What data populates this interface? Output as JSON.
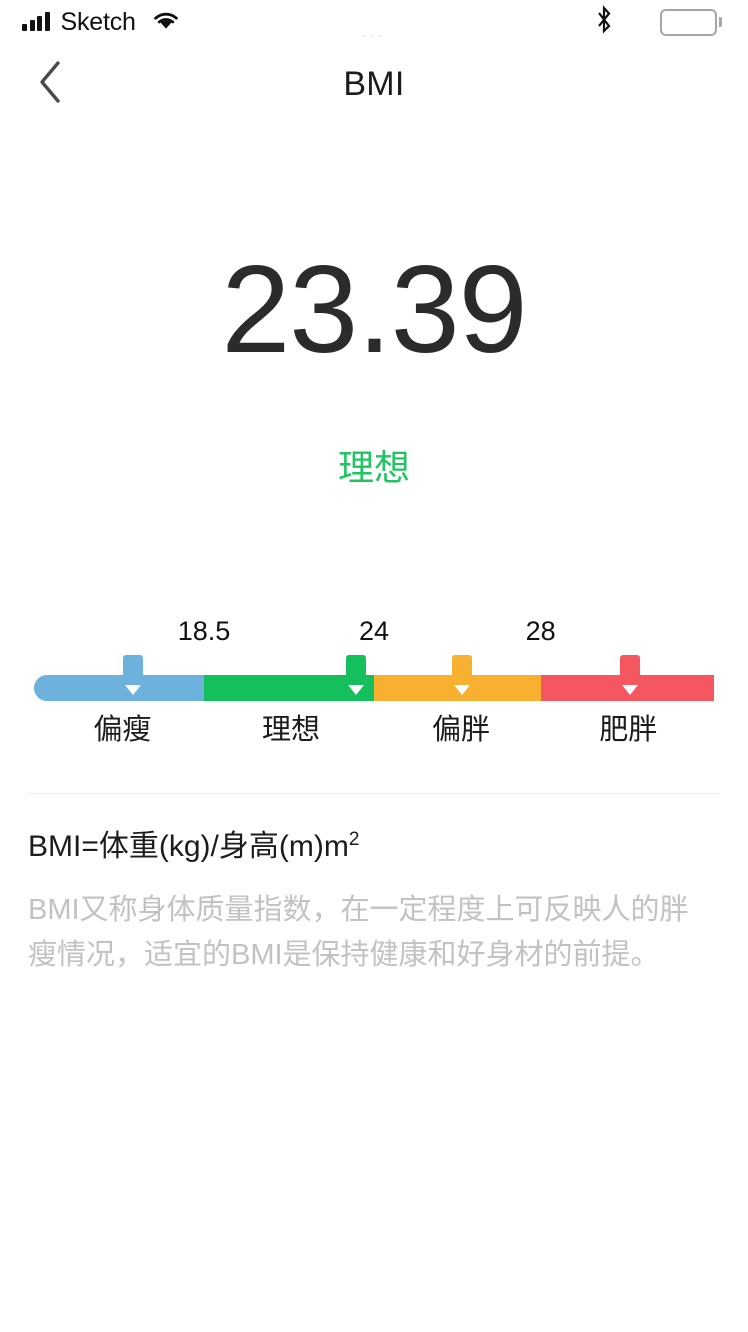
{
  "status_bar": {
    "carrier": "Sketch",
    "signal_icon": "signal-bars-icon",
    "wifi_icon": "wifi-icon",
    "bluetooth_icon": "bluetooth-icon",
    "battery_icon": "battery-full-icon",
    "notch_dots": "···"
  },
  "nav": {
    "back_icon": "chevron-left-icon",
    "title": "BMI"
  },
  "result": {
    "value": "23.39",
    "status_label": "理想",
    "status_color": "#22c362"
  },
  "scale": {
    "ticks": [
      {
        "label": "18.5",
        "position_pct": 25.0
      },
      {
        "label": "24",
        "position_pct": 50.0
      },
      {
        "label": "28",
        "position_pct": 74.5
      }
    ],
    "segments": [
      {
        "label": "偏瘦",
        "color": "#6cb2dd",
        "width_pct": 25.0,
        "label_pos_pct": 13.0
      },
      {
        "label": "理想",
        "color": "#14bf5c",
        "width_pct": 25.0,
        "label_pos_pct": 37.8
      },
      {
        "label": "偏胖",
        "color": "#f7b030",
        "width_pct": 24.5,
        "label_pos_pct": 62.8
      },
      {
        "label": "肥胖",
        "color": "#f4575f",
        "width_pct": 25.5,
        "label_pos_pct": 87.4
      }
    ],
    "markers": [
      {
        "position_pct": 14.6,
        "color": "#6cb2dd"
      },
      {
        "position_pct": 47.3,
        "color": "#14bf5c"
      },
      {
        "position_pct": 63.0,
        "color": "#f7b030"
      },
      {
        "position_pct": 87.6,
        "color": "#f4575f"
      }
    ]
  },
  "info": {
    "formula_prefix": "BMI=体重(kg)/身高(m)m",
    "formula_exponent": "2",
    "description": "BMI又称身体质量指数，在一定程度上可反映人的胖瘦情况，适宜的BMI是保持健康和好身材的前提。"
  }
}
